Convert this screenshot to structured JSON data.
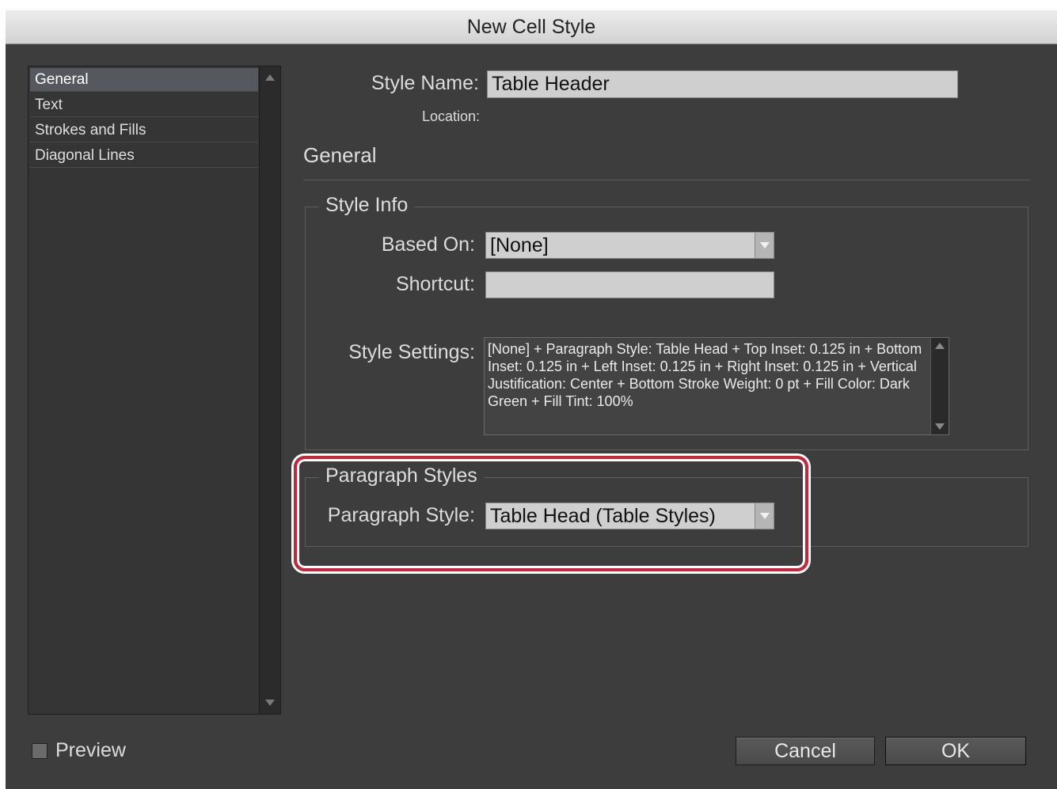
{
  "dialog": {
    "title": "New Cell Style"
  },
  "sidebar": {
    "items": [
      {
        "label": "General",
        "selected": true
      },
      {
        "label": "Text"
      },
      {
        "label": "Strokes and Fills"
      },
      {
        "label": "Diagonal Lines"
      }
    ]
  },
  "header": {
    "style_name_label": "Style Name:",
    "style_name_value": "Table Header",
    "location_label": "Location:"
  },
  "general": {
    "heading": "General",
    "style_info": {
      "legend": "Style Info",
      "based_on_label": "Based On:",
      "based_on_value": "[None]",
      "shortcut_label": "Shortcut:",
      "shortcut_value": "",
      "style_settings_label": "Style Settings:",
      "style_settings_text": "[None] + Paragraph Style: Table Head + Top Inset: 0.125 in + Bottom Inset: 0.125 in + Left Inset: 0.125 in + Right Inset: 0.125 in + Vertical Justification: Center + Bottom Stroke Weight: 0 pt + Fill Color: Dark Green + Fill Tint: 100%"
    },
    "paragraph_styles": {
      "legend": "Paragraph Styles",
      "paragraph_style_label": "Paragraph Style:",
      "paragraph_style_value": "Table Head (Table Styles)"
    }
  },
  "footer": {
    "preview_label": "Preview",
    "preview_checked": false,
    "cancel_label": "Cancel",
    "ok_label": "OK"
  },
  "colors": {
    "dialog_bg": "#3d3d3d",
    "highlight": "#c8253a",
    "selected_item": "#55585e"
  }
}
